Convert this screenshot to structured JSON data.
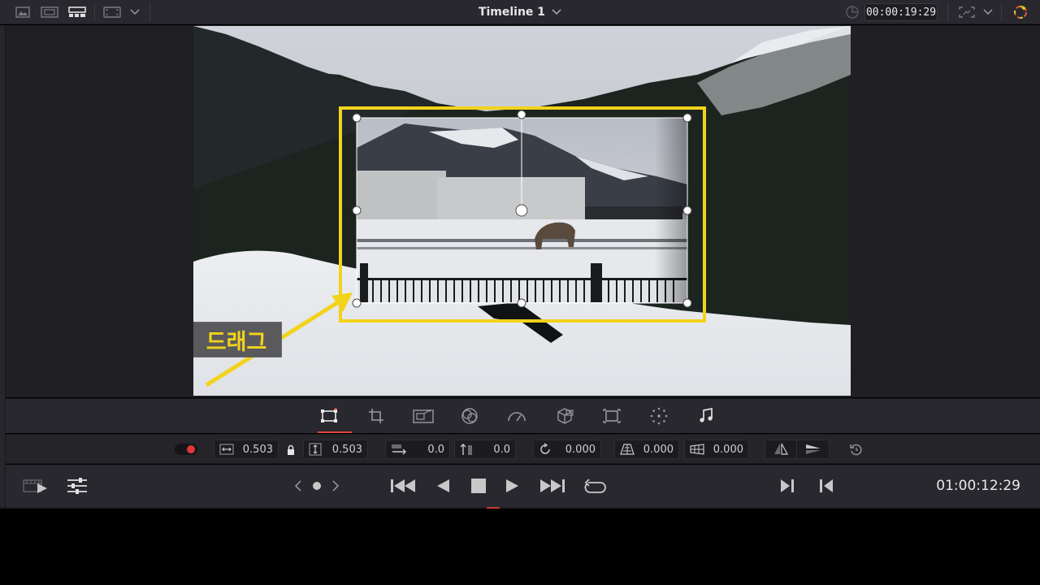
{
  "topbar": {
    "title": "Timeline 1",
    "timecode": "00:00:19:29"
  },
  "annotation": {
    "label": "드래그",
    "accent": "#f2d31b"
  },
  "toolbar": {
    "tools": [
      "transform-icon",
      "crop-icon",
      "dynamic-zoom-icon",
      "open-fx-overlay-icon",
      "speed-icon",
      "fusion-overlay-icon",
      "smart-reframe-icon",
      "annotations-icon",
      "audio-icon"
    ],
    "active": "transform-icon",
    "active_color": "#e2483c"
  },
  "params": {
    "zoom_x": "0.503",
    "zoom_y": "0.503",
    "position_x": "0.0",
    "position_y": "0.0",
    "rotation": "0.000",
    "pitch": "0.000",
    "yaw": "0.000"
  },
  "transport": {
    "timecode": "01:00:12:29"
  }
}
